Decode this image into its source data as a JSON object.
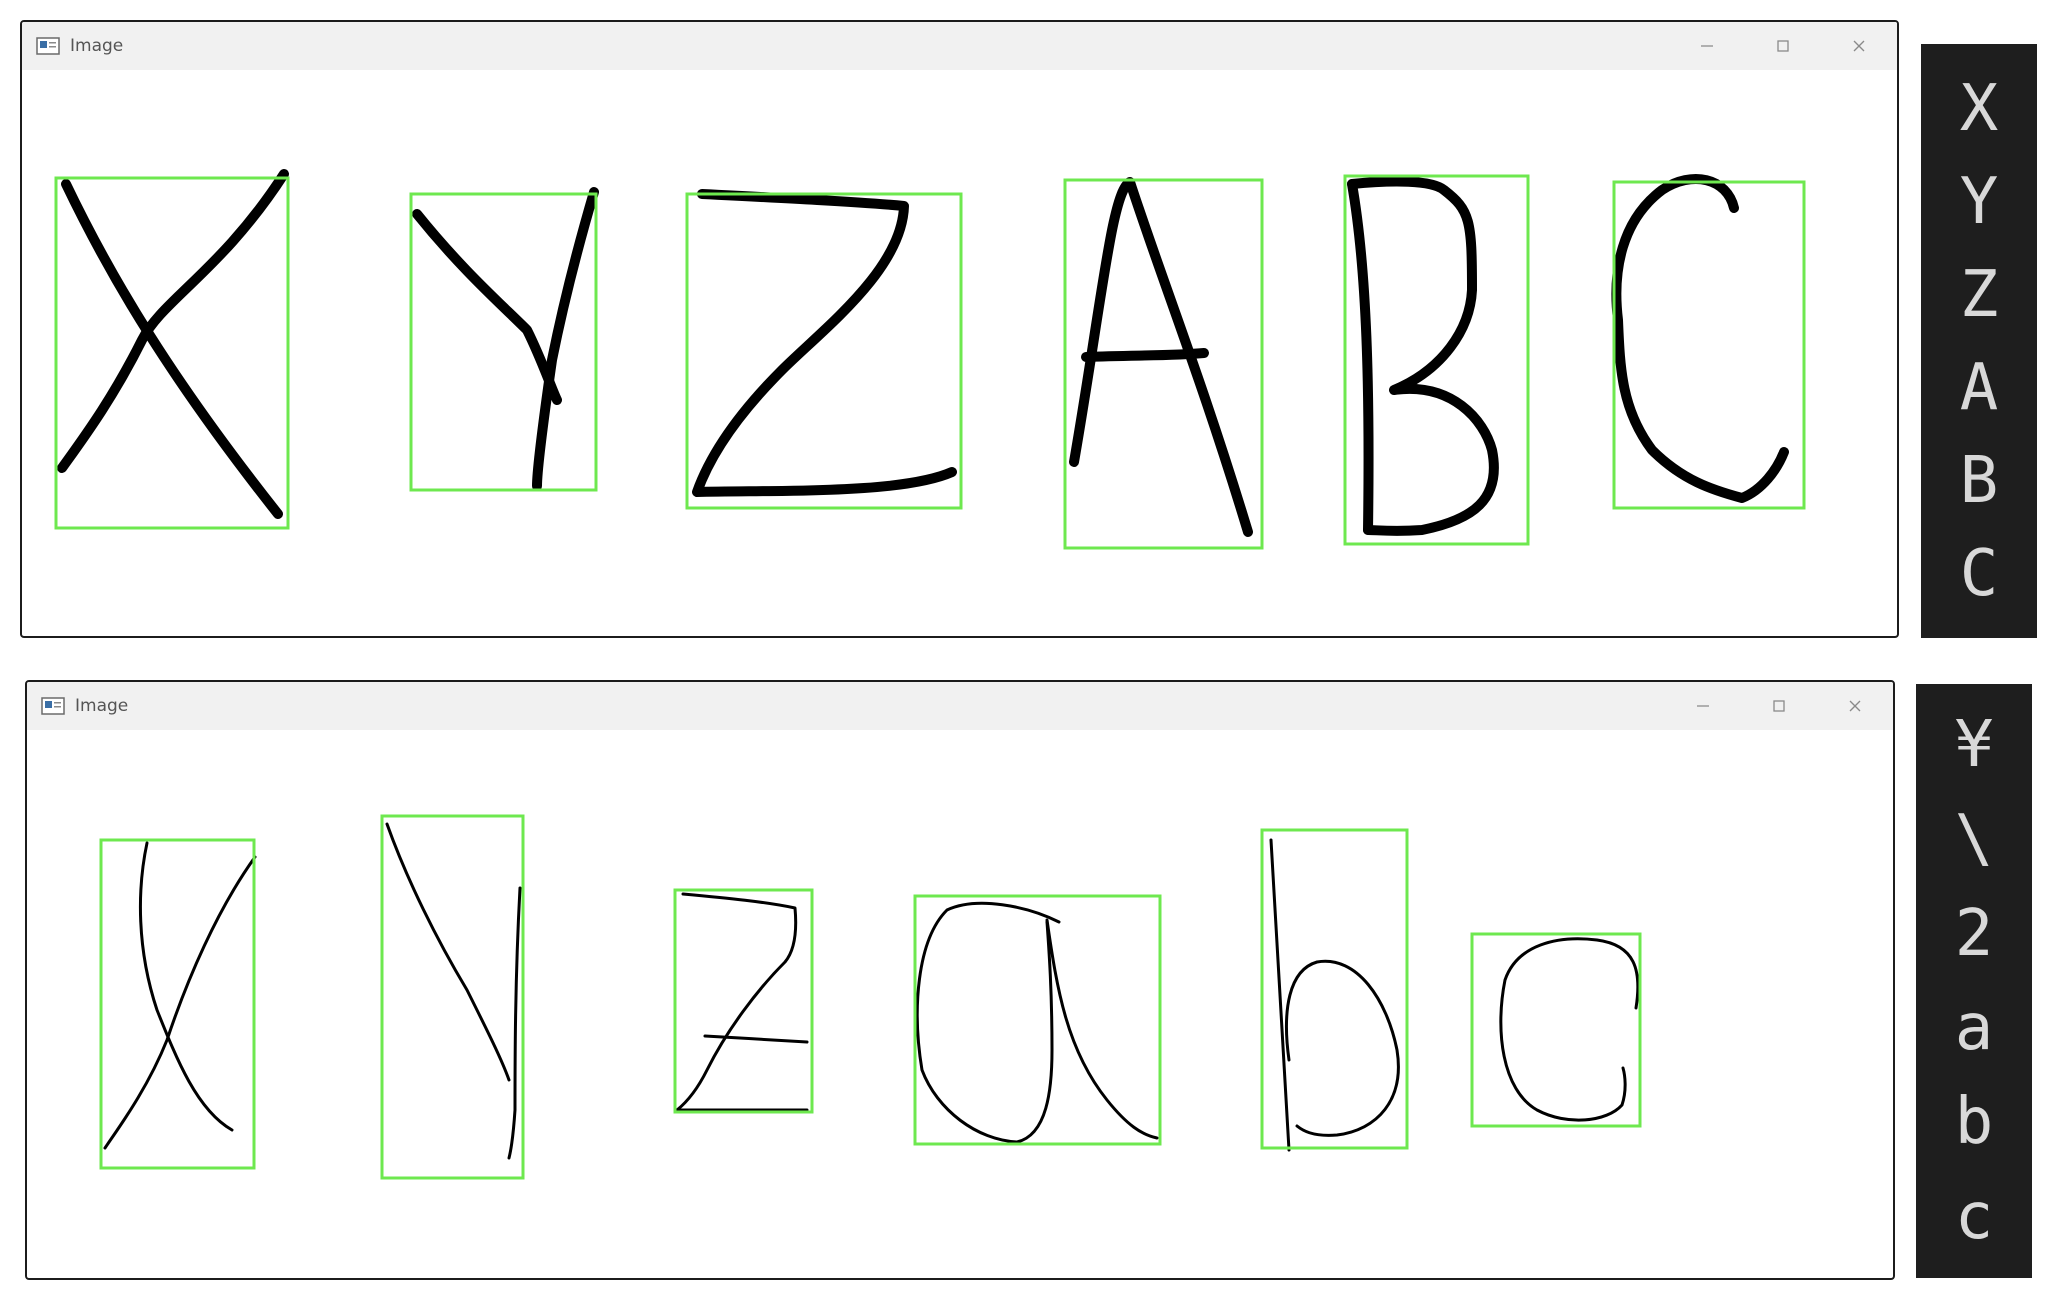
{
  "windows": [
    {
      "title": "Image",
      "detections": [
        "X",
        "Y",
        "Z",
        "A",
        "B",
        "C"
      ]
    },
    {
      "title": "Image",
      "detections": [
        "¥",
        "\\",
        "2",
        "a",
        "b",
        "c"
      ]
    }
  ],
  "colors": {
    "box": "#6ee84f",
    "stroke": "#000000",
    "panel_bg": "#1e1e1e",
    "panel_text": "#d8d8d8"
  },
  "icons": {
    "app": "image-window-icon",
    "minimize": "minimize-icon",
    "maximize": "maximize-icon",
    "close": "close-icon"
  }
}
